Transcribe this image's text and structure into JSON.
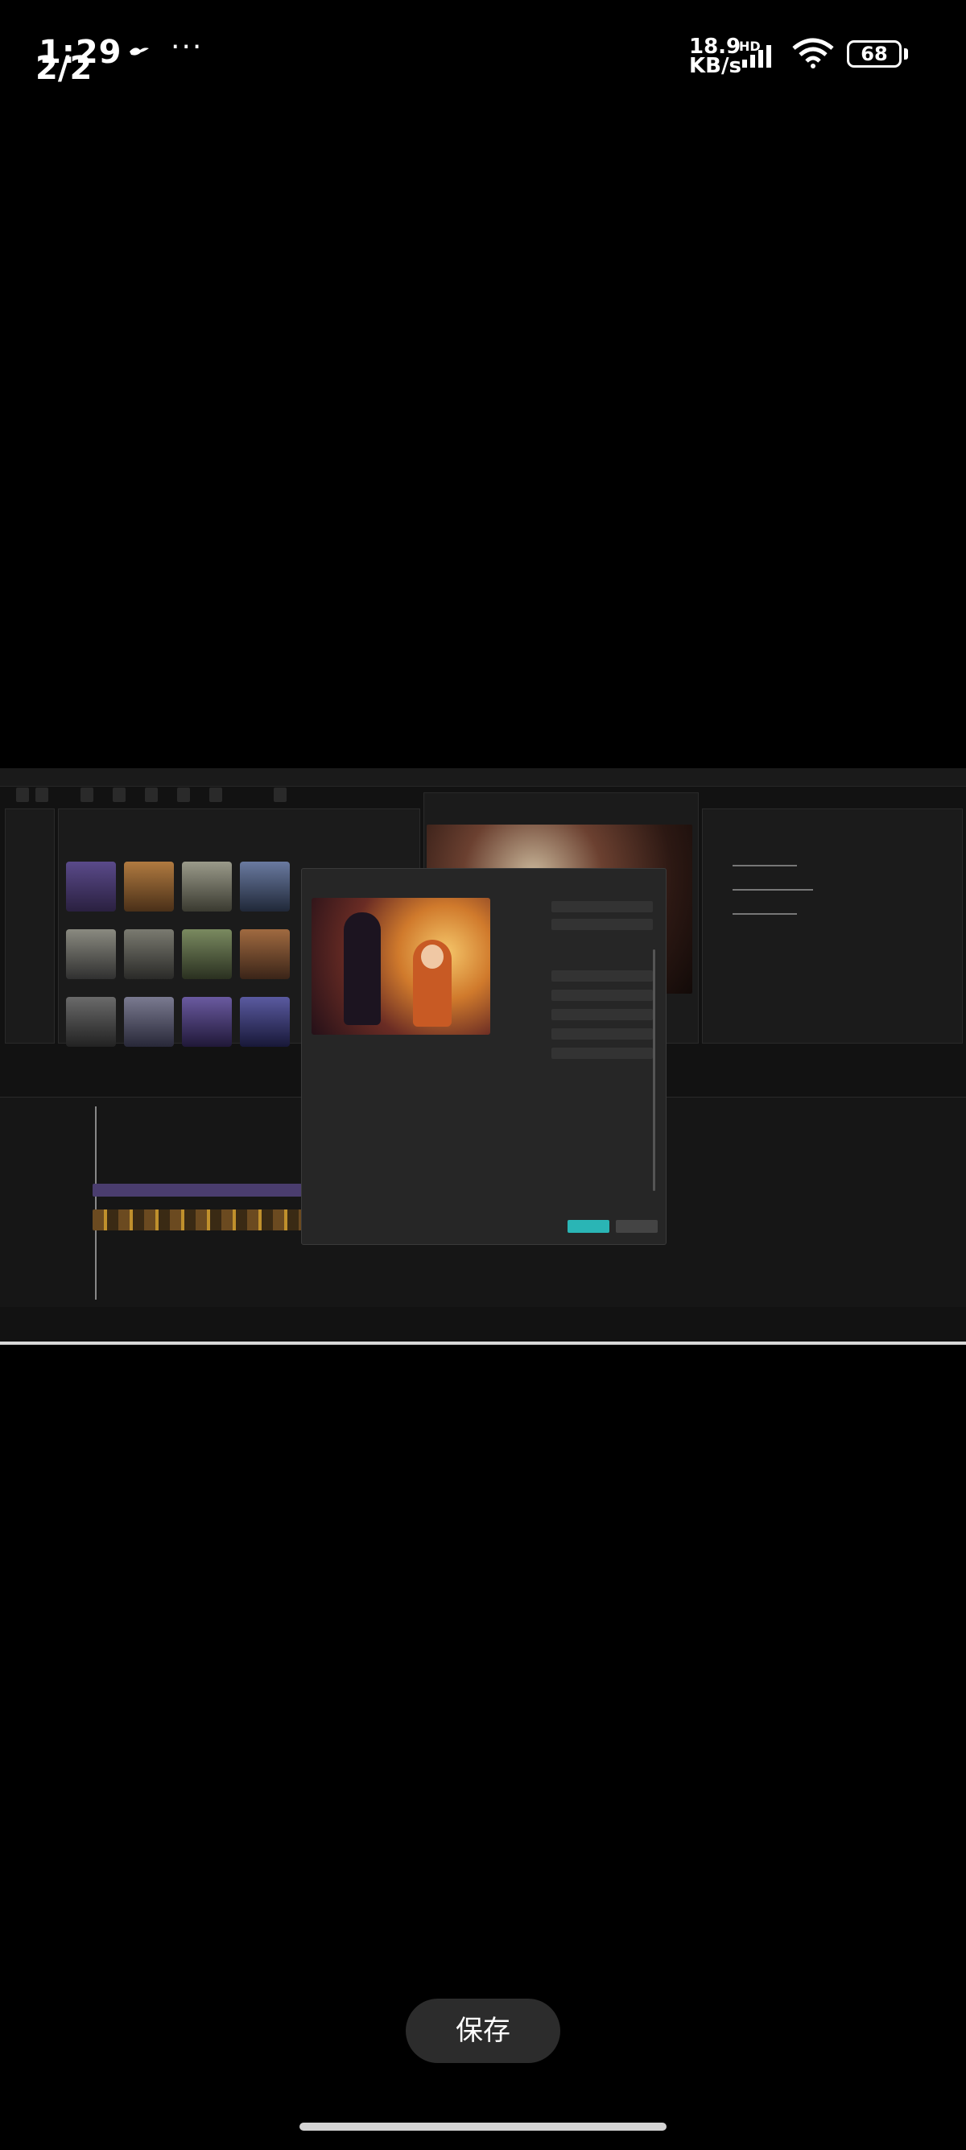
{
  "status_bar": {
    "time": "1:29",
    "page_counter": "2/2",
    "more": "···",
    "net_speed_value": "18.9",
    "net_speed_unit": "KB/s",
    "network_badge": "HD",
    "battery": "68"
  },
  "actions": {
    "save_label": "保存"
  }
}
